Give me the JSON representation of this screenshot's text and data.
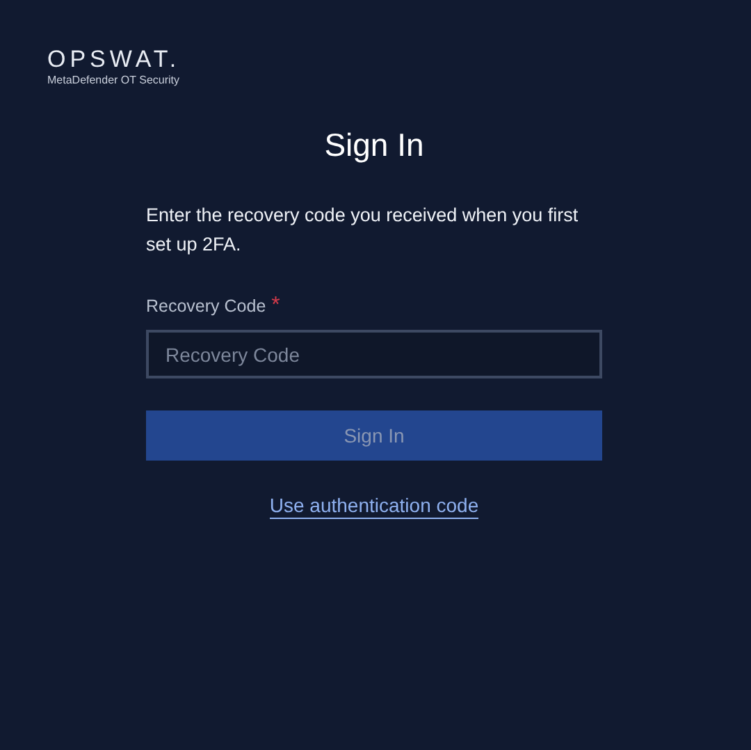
{
  "brand": {
    "logo": "OPSWAT.",
    "product": "MetaDefender OT Security"
  },
  "title": "Sign In",
  "instruction": "Enter the recovery code you received when you first set up 2FA.",
  "field": {
    "label": "Recovery Code",
    "required_mark": "*",
    "placeholder": "Recovery Code"
  },
  "submit": {
    "label": "Sign In",
    "disabled": true
  },
  "link": "Use authentication code"
}
